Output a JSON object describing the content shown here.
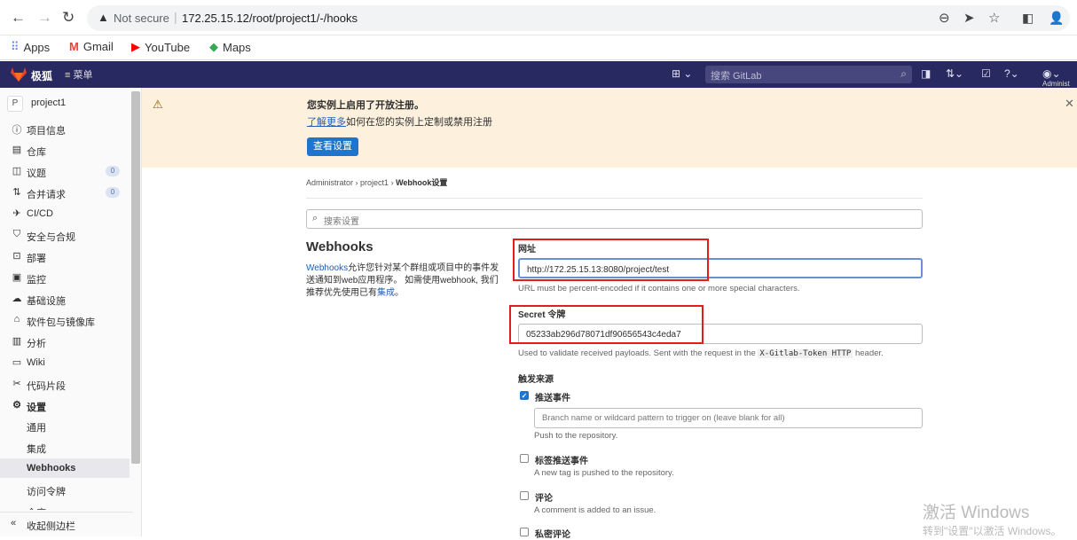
{
  "browser": {
    "not_secure": "Not secure",
    "url": "172.25.15.12/root/project1/-/hooks",
    "bookmarks": [
      "Apps",
      "Gmail",
      "YouTube",
      "Maps"
    ]
  },
  "topbar": {
    "brand": "极狐",
    "menu": "菜单",
    "search_placeholder": "搜索 GitLab",
    "user": "Administ"
  },
  "sidebar": {
    "avatar_letter": "P",
    "project": "project1",
    "items": [
      {
        "label": "项目信息",
        "icon": "info-icon"
      },
      {
        "label": "仓库",
        "icon": "repo-icon"
      },
      {
        "label": "议题",
        "icon": "issues-icon",
        "badge": "0"
      },
      {
        "label": "合并请求",
        "icon": "merge-request-icon",
        "badge": "0"
      },
      {
        "label": "CI/CD",
        "icon": "rocket-icon"
      },
      {
        "label": "安全与合规",
        "icon": "shield-icon"
      },
      {
        "label": "部署",
        "icon": "deploy-icon"
      },
      {
        "label": "监控",
        "icon": "monitor-icon"
      },
      {
        "label": "基础设施",
        "icon": "cloud-icon"
      },
      {
        "label": "软件包与镜像库",
        "icon": "package-icon"
      },
      {
        "label": "分析",
        "icon": "chart-icon"
      },
      {
        "label": "Wiki",
        "icon": "book-icon"
      },
      {
        "label": "代码片段",
        "icon": "scissors-icon"
      },
      {
        "label": "设置",
        "icon": "gear-icon"
      }
    ],
    "settings_sub": [
      "通用",
      "集成",
      "Webhooks",
      "访问令牌",
      "仓库"
    ],
    "collapse": "收起侧边栏"
  },
  "alert": {
    "title": "您实例上启用了开放注册。",
    "link": "了解更多",
    "body": "如何在您的实例上定制或禁用注册",
    "button": "查看设置"
  },
  "breadcrumb": [
    "Administrator",
    "project1",
    "Webhook设置"
  ],
  "search_settings": "搜索设置",
  "webhooks": {
    "title": "Webhooks",
    "desc_link": "Webhooks",
    "desc": "允许您针对某个群组或项目中的事件发送通知到web应用程序。 如需使用webhook, 我们推荐优先使用已有",
    "desc_link2": "集成",
    "desc_end": "。"
  },
  "form": {
    "url_label": "网址",
    "url_value": "http://172.25.15.13:8080/project/test",
    "url_help": "URL must be percent-encoded if it contains one or more special characters.",
    "secret_label": "Secret 令牌",
    "secret_value": "05233ab296d78071df90656543c4eda7",
    "secret_help_a": "Used to validate received payloads. Sent with the request in the",
    "secret_help_tag": "X-Gitlab-Token HTTP",
    "secret_help_b": "header.",
    "trigger_label": "触发来源",
    "events": [
      {
        "label": "推送事件",
        "checked": true,
        "help": "Push to the repository."
      },
      {
        "label": "标签推送事件",
        "checked": false,
        "help": "A new tag is pushed to the repository."
      },
      {
        "label": "评论",
        "checked": false,
        "help": "A comment is added to an issue."
      },
      {
        "label": "私密评论",
        "checked": false,
        "help": ""
      }
    ],
    "branch_placeholder": "Branch name or wildcard pattern to trigger on (leave blank for all)"
  },
  "watermark": {
    "line1": "激活 Windows",
    "line2": "转到\"设置\"以激活 Windows。"
  }
}
